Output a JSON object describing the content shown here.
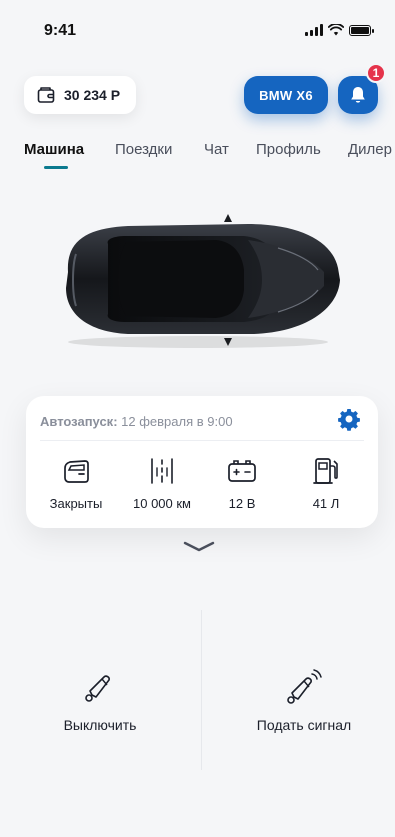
{
  "status_bar": {
    "time": "9:41"
  },
  "header": {
    "balance": "30 234 Р",
    "car_model": "BMW X6",
    "notifications_count": "1"
  },
  "tabs": [
    {
      "label": "Машина",
      "active": true
    },
    {
      "label": "Поездки",
      "active": false
    },
    {
      "label": "Чат",
      "active": false
    },
    {
      "label": "Профиль",
      "active": false
    },
    {
      "label": "Дилер",
      "active": false
    }
  ],
  "card": {
    "autostart_label": "Автозапуск:",
    "autostart_value": "12 февраля в 9:00",
    "stats": [
      {
        "icon": "car-door-icon",
        "label": "Закрыты"
      },
      {
        "icon": "odometer-icon",
        "label": "10 000 км"
      },
      {
        "icon": "battery-icon",
        "label": "12 В"
      },
      {
        "icon": "fuel-pump-icon",
        "label": "41 Л"
      }
    ]
  },
  "actions": [
    {
      "icon": "horn-icon",
      "label": "Выключить"
    },
    {
      "icon": "horn-sound-icon",
      "label": "Подать сигнал"
    }
  ],
  "colors": {
    "accent": "#1565c0",
    "tab_indicator": "#0b7a8f",
    "badge": "#e5334b"
  }
}
